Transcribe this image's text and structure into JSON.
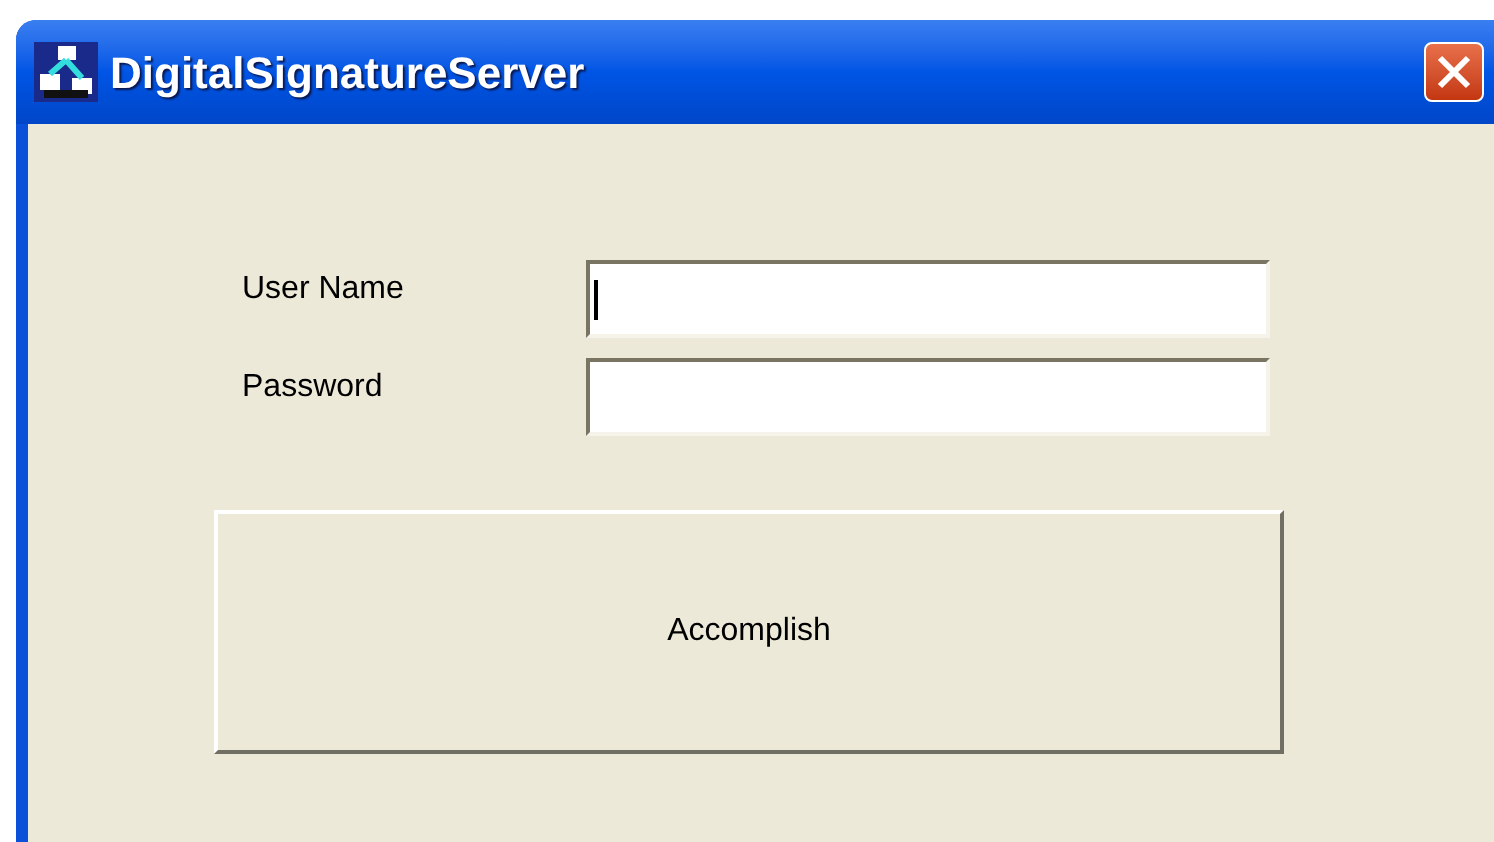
{
  "window": {
    "title": "DigitalSignatureServer"
  },
  "fields": [
    {
      "label": "User Name",
      "focused": true
    },
    {
      "label": "Password",
      "focused": false
    }
  ],
  "buttons": [
    "Accomplish"
  ]
}
